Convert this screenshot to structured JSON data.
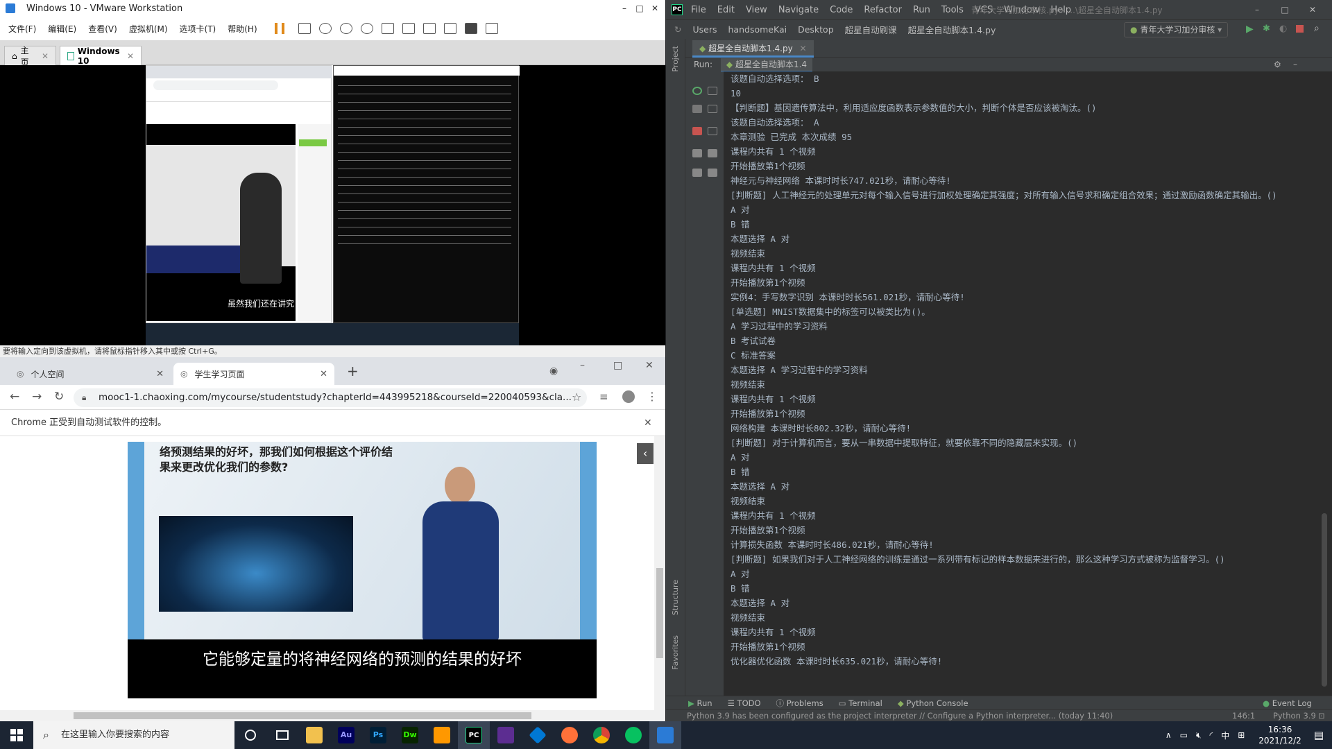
{
  "vmware": {
    "title": "Windows 10 - VMware Workstation",
    "menu": [
      "文件(F)",
      "编辑(E)",
      "查看(V)",
      "虚拟机(M)",
      "选项卡(T)",
      "帮助(H)"
    ],
    "tabs": [
      "主页",
      "Windows 10"
    ],
    "status": "要将输入定向到该虚拟机，请将鼠标指针移入其中或按 Ctrl+G。",
    "guest_caption": "虽然我们还在讲究"
  },
  "chrome": {
    "tabs": [
      "个人空间",
      "学生学习页面"
    ],
    "url": "mooc1-1.chaoxing.com/mycourse/studentstudy?chapterId=443995218&courseId=220040593&cla...",
    "infobar": "Chrome 正受到自动测试软件的控制。",
    "slide_text": "络预测结果的好坏，那我们如何根据这个评价结果来更改优化我们的参数?",
    "subtitle": "它能够定量的将神经网络的预测的结果的好坏"
  },
  "pycharm": {
    "menu": [
      "File",
      "Edit",
      "View",
      "Navigate",
      "Code",
      "Refactor",
      "Run",
      "Tools",
      "VCS",
      "Window",
      "Help"
    ],
    "window_title": "青年大学习加分审核.py - ...\\超星全自动脚本1.4.py",
    "breadcrumbs": [
      "Users",
      "handsomeKai",
      "Desktop",
      "超星自动刷课",
      "超星全自动脚本1.4.py"
    ],
    "run_config": "青年大学习加分审核",
    "file_tab": "超星全自动脚本1.4.py",
    "run_label": "Run:",
    "run_tab": "超星全自动脚本1.4",
    "console": [
      "该题自动选择选项： B",
      "10",
      "【判断题】基因遗传算法中，利用适应度函数表示参数值的大小，判断个体是否应该被淘汰。()",
      "该题自动选择选项： A",
      "本章测验 已完成 本次成绩 95",
      "课程内共有 1 个视频",
      "开始播放第1个视频",
      "神经元与神经网络 本课时时长747.021秒，请耐心等待!",
      "[判断题] 人工神经元的处理单元对每个输入信号进行加权处理确定其强度；对所有输入信号求和确定组合效果；通过激励函数确定其输出。()",
      "A 对",
      "B 错",
      "本题选择 A 对",
      "视频结束",
      "课程内共有 1 个视频",
      "开始播放第1个视频",
      "实例4：手写数字识别 本课时时长561.021秒，请耐心等待!",
      "[单选题] MNIST数据集中的标签可以被类比为()。",
      "A 学习过程中的学习资料",
      "B 考试试卷",
      "C 标准答案",
      "本题选择 A 学习过程中的学习资料",
      "视频结束",
      "课程内共有 1 个视频",
      "开始播放第1个视频",
      "网络构建 本课时时长802.32秒，请耐心等待!",
      "[判断题] 对于计算机而言，要从一串数据中提取特征，就要依靠不同的隐藏层来实现。()",
      "A 对",
      "B 错",
      "本题选择 A 对",
      "视频结束",
      "课程内共有 1 个视频",
      "开始播放第1个视频",
      "计算损失函数 本课时时长486.021秒，请耐心等待!",
      "[判断题] 如果我们对于人工神经网络的训练是通过一系列带有标记的样本数据来进行的，那么这种学习方式被称为监督学习。()",
      "A 对",
      "B 错",
      "本题选择 A 对",
      "视频结束",
      "课程内共有 1 个视频",
      "开始播放第1个视频",
      "优化器优化函数 本课时时长635.021秒，请耐心等待!"
    ],
    "bottom_tabs": [
      "Run",
      "TODO",
      "Problems",
      "Terminal",
      "Python Console"
    ],
    "event_log": "Event Log",
    "status": "Python 3.9 has been configured as the project interpreter // Configure a Python interpreter... (today 11:40)",
    "position": "146:1",
    "interpreter": "Python 3.9",
    "side_labels": [
      "Project",
      "Structure",
      "Favorites"
    ]
  },
  "taskbar": {
    "search_placeholder": "在这里输入你要搜索的内容",
    "apps": [
      "Au",
      "Ps",
      "Dw",
      "",
      "PC",
      "",
      "",
      "",
      "",
      ""
    ],
    "time": "16:36",
    "date": "2021/12/2",
    "ime": "中"
  }
}
